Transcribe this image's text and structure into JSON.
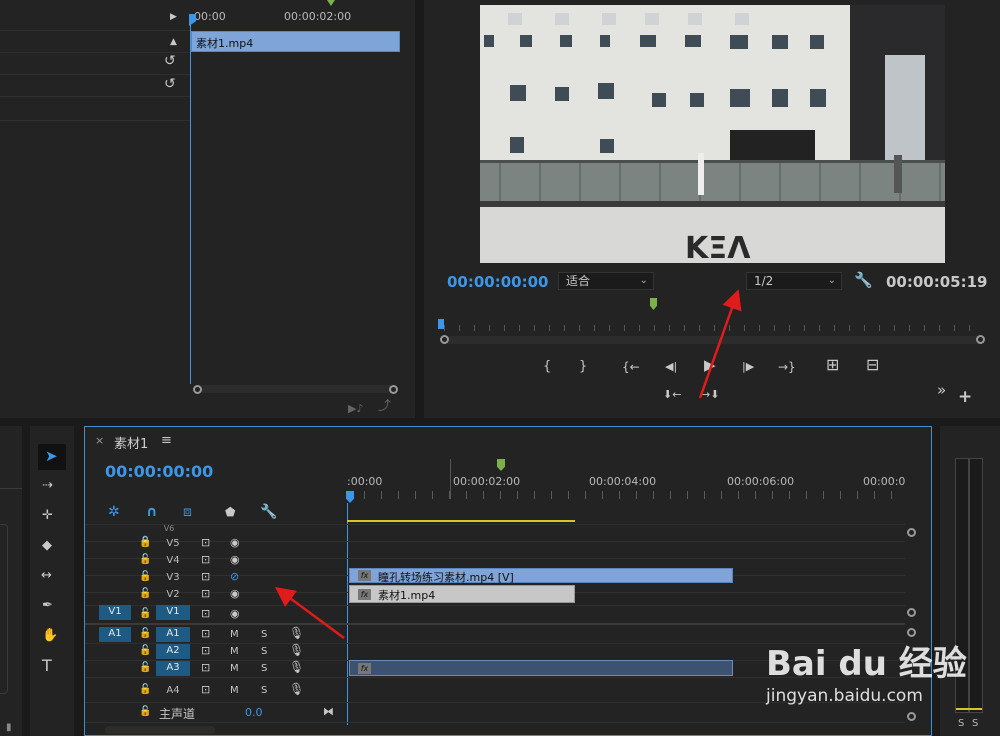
{
  "source_monitor": {
    "ruler_start": "00:00",
    "ruler_mid": "00:00:02:00",
    "clip_name": "素材1.mp4"
  },
  "program_monitor": {
    "timecode": "00:00:00:00",
    "fit_select": "适合",
    "resolution_select": "1/2",
    "duration": "00:00:05:19",
    "preview_lettering": "ΚΞΛ"
  },
  "buttons": {
    "mark_in": "{",
    "mark_out": "}",
    "go_to_in": "{←",
    "step_back": "◀|",
    "play": "▶",
    "step_forward": "|▶",
    "go_to_out": "→}",
    "insert": "⊞",
    "overwrite": "⊟",
    "lift": "⬇←",
    "extract": "→⬇",
    "more": "»",
    "add": "+"
  },
  "timeline": {
    "close": "×",
    "title": "素材1",
    "menu": "≡",
    "timecode": "00:00:00:00",
    "ruler_labels": [
      ":00:00",
      "00:00:02:00",
      "00:00:04:00",
      "00:00:06:00",
      "00:00:0"
    ],
    "video_tracks": [
      {
        "name": "V6",
        "src": ""
      },
      {
        "name": "V5",
        "src": ""
      },
      {
        "name": "V4",
        "src": ""
      },
      {
        "name": "V3",
        "src": ""
      },
      {
        "name": "V2",
        "src": ""
      },
      {
        "name": "V1",
        "src": "V1"
      }
    ],
    "audio_tracks": [
      {
        "name": "A1",
        "src": "A1"
      },
      {
        "name": "A2",
        "src": ""
      },
      {
        "name": "A3",
        "src": ""
      },
      {
        "name": "A4",
        "src": ""
      }
    ],
    "mute_label": "M",
    "solo_label": "S",
    "master_label": "主声道",
    "master_value": "0.0",
    "clips": {
      "v3_clip": "瞳孔转场练习素材.mp4 [V]",
      "v2_clip": "素材1.mp4",
      "fx": "fx"
    }
  },
  "meter": {
    "solo_left": "S",
    "solo_right": "S"
  },
  "watermark": {
    "brand": "Bai du 经验",
    "url": "jingyan.baidu.com"
  },
  "colors": {
    "accent_blue": "#3d97e8",
    "clip_blue": "#7ea4d8",
    "clip_gray": "#c7c7c7",
    "marker_green": "#7db04a",
    "work_area_yellow": "#d9c22a",
    "annotation_red": "#e01b1b"
  }
}
